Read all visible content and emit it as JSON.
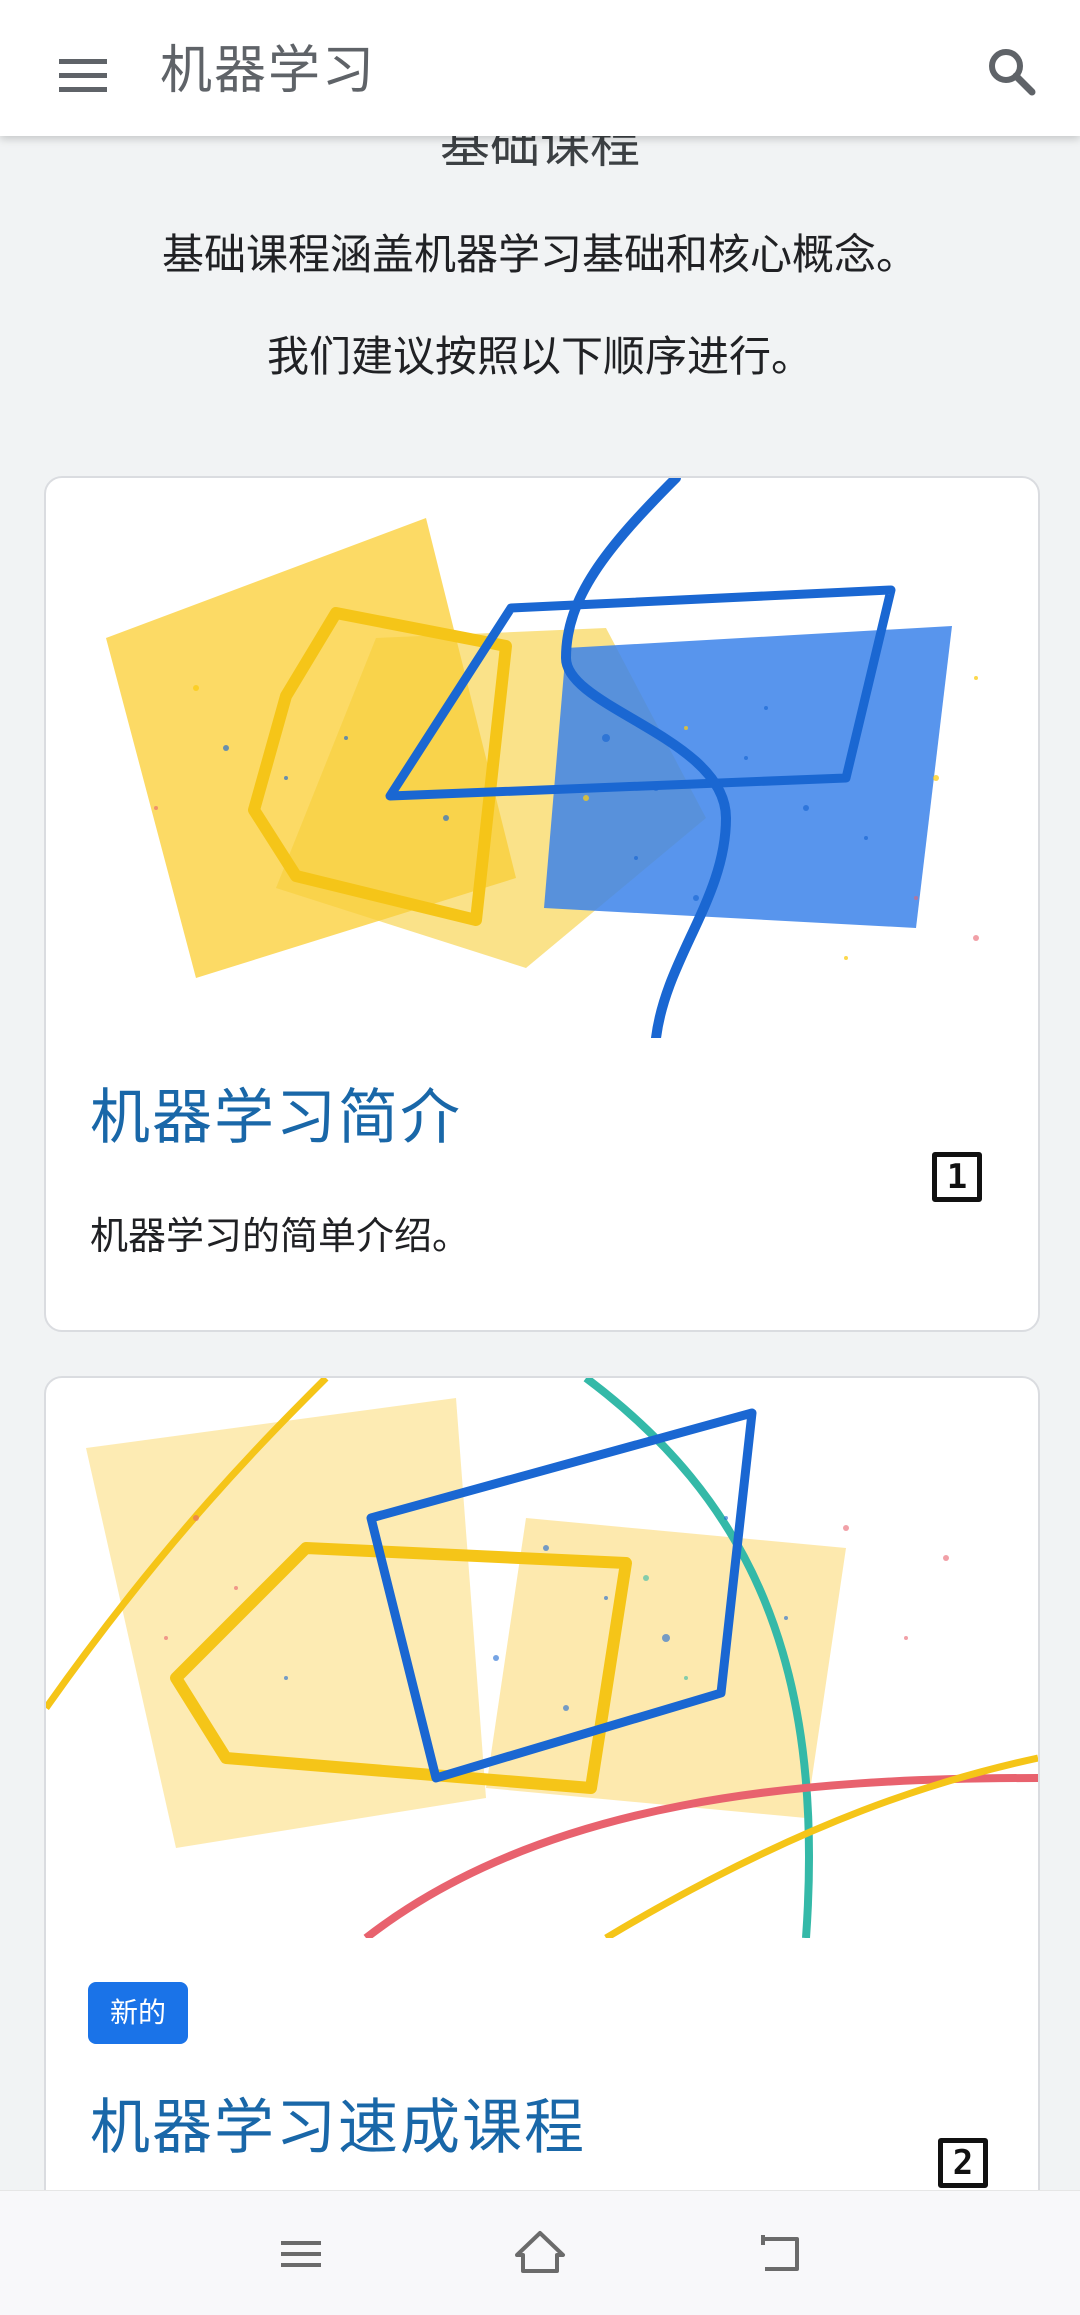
{
  "app_bar": {
    "title": "机器学习",
    "menu_icon": "hamburger-menu-icon",
    "search_icon": "search-icon"
  },
  "section": {
    "heading": "基础课程",
    "intro_line_1": "基础课程涵盖机器学习基础和核心概念。",
    "intro_line_2": "我们建议按照以下顺序进行。"
  },
  "courses": [
    {
      "title": "机器学习简介",
      "description": "机器学习的简单介绍。",
      "order": "1"
    },
    {
      "badge": "新的",
      "title": "机器学习速成课程",
      "order": "2"
    }
  ],
  "nav_bar": {
    "icons": [
      "recent-apps-icon",
      "home-icon",
      "back-icon"
    ]
  },
  "colors": {
    "accent": "#1a73e8",
    "title_blue": "#1967a8",
    "art_yellow": "#fbcb13",
    "art_blue": "#1a67d2",
    "art_teal": "#34b9a8",
    "art_red": "#e8626e"
  }
}
